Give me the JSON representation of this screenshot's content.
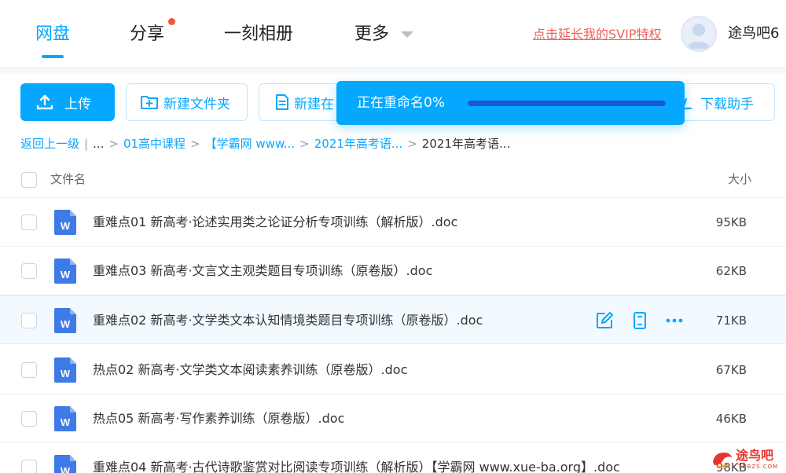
{
  "nav": {
    "tabs": [
      {
        "label": "网盘",
        "active": true
      },
      {
        "label": "分享",
        "has_badge": true
      },
      {
        "label": "一刻相册"
      },
      {
        "label": "更多"
      }
    ],
    "svip_link": "点击延长我的SVIP特权",
    "username": "途鸟吧6"
  },
  "toolbar": {
    "upload_label": "上传",
    "new_folder_label": "新建文件夹",
    "new_doc_label": "新建在",
    "download_helper_label": "下载助手"
  },
  "toast": {
    "text": "正在重命名0%",
    "progress": 0.0
  },
  "breadcrumb": {
    "back": "返回上一级",
    "ellipsis": "...",
    "items": [
      "01高中课程",
      "【学霸网 www...",
      "2021年高考语..."
    ],
    "current": "2021年高考语..."
  },
  "table": {
    "col_name": "文件名",
    "col_size": "大小",
    "rows": [
      {
        "name": "重难点01 新高考·论述实用类之论证分析专项训练（解析版）.doc",
        "size": "95KB"
      },
      {
        "name": "重难点03 新高考·文言文主观类题目专项训练（原卷版）.doc",
        "size": "62KB"
      },
      {
        "name": "重难点02 新高考·文学类文本认知情境类题目专项训练（原卷版）.doc",
        "size": "71KB",
        "hover": true
      },
      {
        "name": "热点02 新高考·文学类文本阅读素养训练（原卷版）.doc",
        "size": "67KB"
      },
      {
        "name": "热点05 新高考·写作素养训练（原卷版）.doc",
        "size": "46KB"
      },
      {
        "name": "重难点04 新高考·古代诗歌鉴赏对比阅读专项训练（解析版）【学霸网 www.xue-ba.org】.doc",
        "size": "98KB"
      }
    ]
  },
  "watermark": {
    "text": "途鸟吧",
    "sub": "TNBZS.COM"
  },
  "colors": {
    "accent": "#06a7ff",
    "progress_bar": "#1a56d6",
    "svip_link": "#f0605a",
    "word_icon": "#3f7be8"
  },
  "icons": [
    "upload-icon",
    "folder-plus-icon",
    "doc-icon",
    "download-icon",
    "word-doc-icon",
    "rename-icon",
    "phone-icon",
    "more-icon"
  ]
}
